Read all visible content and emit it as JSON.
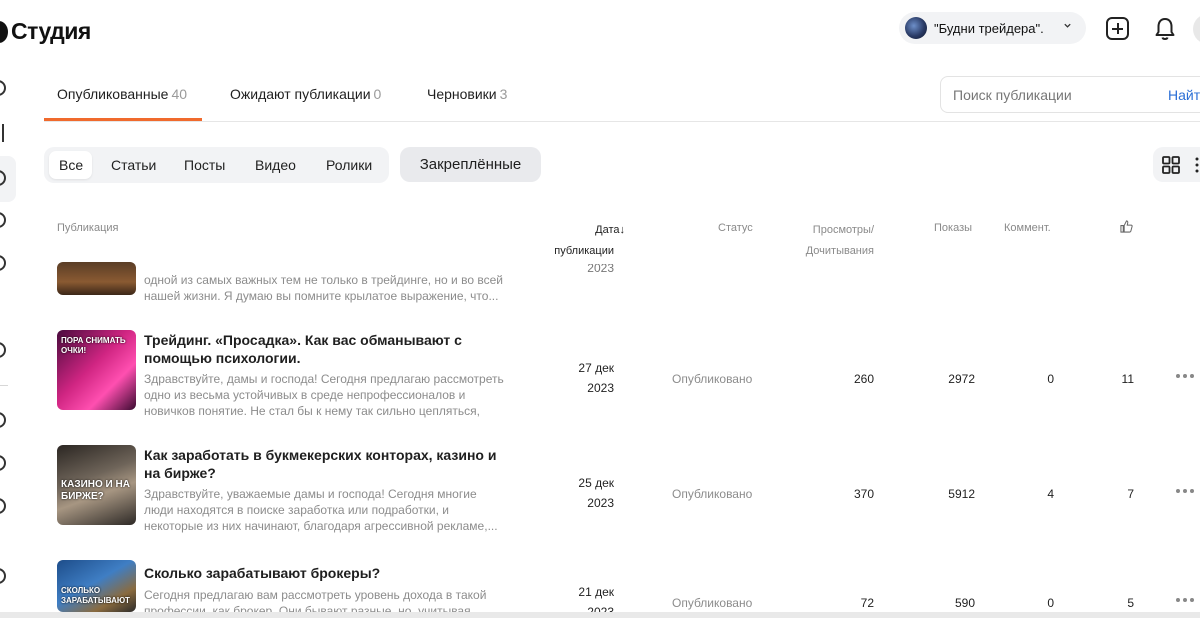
{
  "app": {
    "title": "Студия"
  },
  "header": {
    "channel_name": "\"Будни трейдера\"."
  },
  "tabs": [
    {
      "label": "Опубликованные",
      "count": "40"
    },
    {
      "label": "Ожидают публикации",
      "count": "0"
    },
    {
      "label": "Черновики",
      "count": "3"
    }
  ],
  "search": {
    "placeholder": "Поиск публикации",
    "button": "Найти"
  },
  "filters": [
    "Все",
    "Статьи",
    "Посты",
    "Видео",
    "Ролики"
  ],
  "pinned_label": "Закреплённые",
  "table": {
    "headers": {
      "publication": "Публикация",
      "date_line1": "Дата↓",
      "date_line2": "публикации",
      "status": "Статус",
      "views_line1": "Просмотры/",
      "views_line2": "Дочитывания",
      "impressions": "Показы",
      "comments": "Коммент."
    },
    "partial_row": {
      "excerpt": "одной из самых важных тем не только в трейдинге, но и во всей нашей жизни. Я думаю вы помните крылатое выражение, что...",
      "date": "2023"
    },
    "rows": [
      {
        "title": "Трейдинг. «Просадка». Как вас обманывают с помощью психологии.",
        "excerpt": "Здравствуйте, дамы и господа! Сегодня предлагаю рассмотреть одно из весьма устойчивых в среде непрофессионалов и новичков понятие. Не стал бы к нему так сильно цепляться, но...",
        "date_day": "27 дек",
        "date_year": "2023",
        "status": "Опубликовано",
        "views": "260",
        "impressions": "2972",
        "comments": "0",
        "likes": "11",
        "thumb_text": "ПОРА СНИМАТЬ ОЧКИ!"
      },
      {
        "title": "Как заработать в букмекерских конторах, казино и на бирже?",
        "excerpt": "Здравствуйте, уважаемые дамы и господа! Сегодня многие люди находятся в поиске заработка или подработки, и некоторые из них начинают, благодаря агрессивной рекламе,...",
        "date_day": "25 дек",
        "date_year": "2023",
        "status": "Опубликовано",
        "views": "370",
        "impressions": "5912",
        "comments": "4",
        "likes": "7",
        "thumb_text": "КАЗИНО И НА БИРЖЕ?"
      },
      {
        "title": "Сколько зарабатывают брокеры?",
        "excerpt": "Сегодня предлагаю вам рассмотреть уровень дохода в такой профессии, как брокер. Они бывают разные, но, учитывая...",
        "date_day": "21 дек",
        "date_year": "2023",
        "status": "Опубликовано",
        "views": "72",
        "impressions": "590",
        "comments": "0",
        "likes": "5",
        "thumb_text": "СКОЛЬКО ЗАРАБАТЫВАЮТ"
      }
    ]
  },
  "colors": {
    "accent": "#f06a2d",
    "link": "#2b6fd6",
    "muted": "#8c8c8c"
  }
}
